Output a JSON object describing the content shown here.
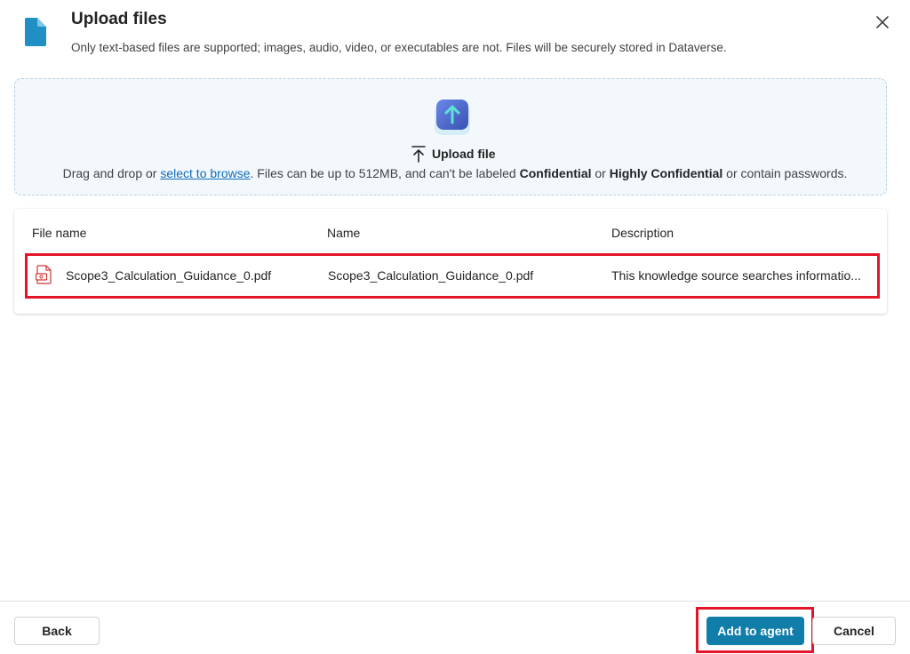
{
  "header": {
    "title": "Upload files",
    "subtitle": "Only text-based files are supported; images, audio, video, or executables are not. Files will be securely stored in Dataverse.",
    "icon": "document-icon",
    "close_icon": "close-icon"
  },
  "dropzone": {
    "upload_label": "Upload file",
    "text_prefix": "Drag and drop or ",
    "browse_link": "select to browse",
    "text_middle": ". Files can be up to 512MB, and can't be labeled ",
    "confidential": "Confidential",
    "text_or": " or ",
    "highly_confidential": "Highly Confidential",
    "text_suffix": " or contain passwords."
  },
  "table": {
    "columns": [
      "File name",
      "Name",
      "Description"
    ],
    "rows": [
      {
        "file_name": "Scope3_Calculation_Guidance_0.pdf",
        "name": "Scope3_Calculation_Guidance_0.pdf",
        "description": "This knowledge source searches informatio..."
      }
    ]
  },
  "footer": {
    "back_label": "Back",
    "add_label": "Add to agent",
    "cancel_label": "Cancel"
  },
  "colors": {
    "primary": "#117eaa",
    "highlight": "#e3152b",
    "link": "#0f6cbd",
    "dropzone_bg": "#f2f8fc"
  }
}
